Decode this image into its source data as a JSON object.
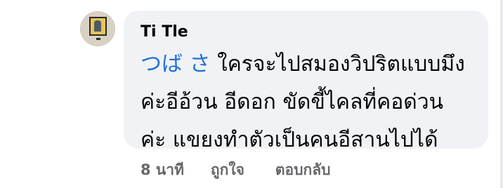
{
  "comment": {
    "author": "Ti Tle",
    "mention": "つば さ",
    "text_line1_rest": " ใครจะไปสมองวิปริตแบบมึง",
    "text_line2": "ค่ะอีอ้วน อีดอก ขัดขี้ไคลที่คอด่วน",
    "text_line3": "ค่ะ แขยงทำตัวเป็นคนอีสานไปได้"
  },
  "actions": {
    "timestamp": "8 นาที",
    "like_label": "ถูกใจ",
    "reply_label": "ตอบกลับ"
  },
  "colors": {
    "bubble_bg": "#f0f2f5",
    "mention": "#216fdb",
    "action_text": "#65676b",
    "text": "#050505"
  }
}
